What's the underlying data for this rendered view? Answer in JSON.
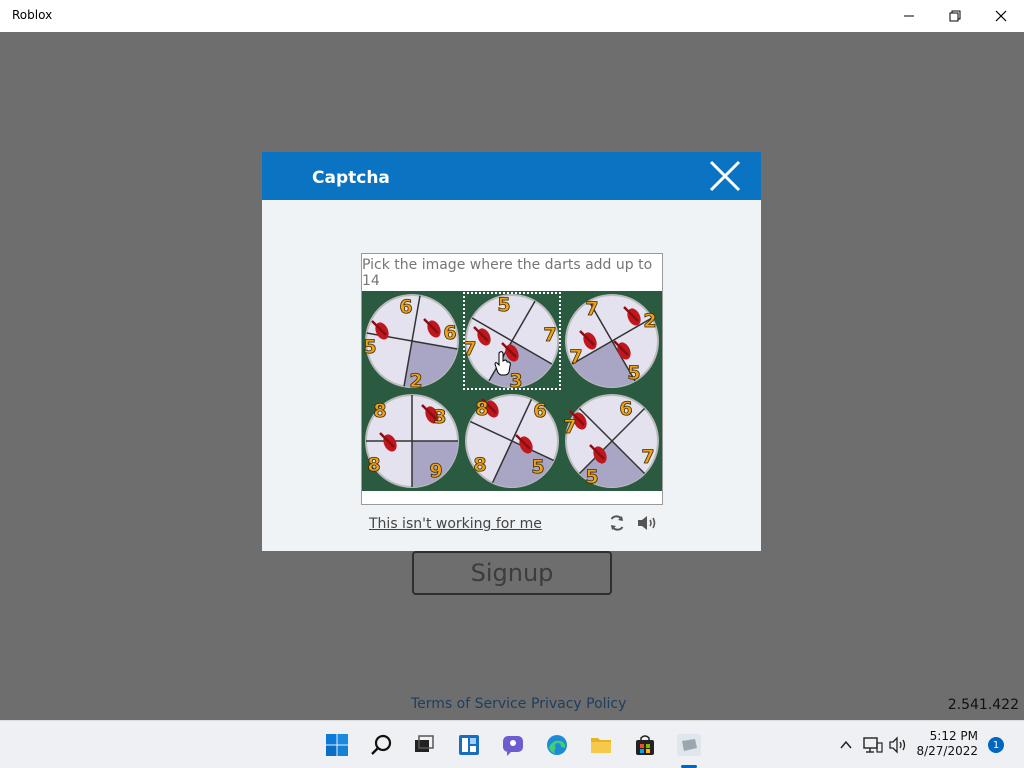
{
  "window": {
    "title": "Roblox",
    "controls": [
      "minimize-icon",
      "restore-icon",
      "close-icon"
    ]
  },
  "page": {
    "signup_label": "Signup",
    "footer": {
      "terms": "Terms of Service",
      "privacy": "Privacy Policy"
    },
    "version": "2.541.422"
  },
  "captcha": {
    "title": "Captcha",
    "prompt": "Pick the image where the darts add up to 14",
    "selected_index": 1,
    "tiles": [
      {
        "numbers": [
          "6",
          "6",
          "5",
          "2"
        ]
      },
      {
        "numbers": [
          "5",
          "7",
          "7",
          "3"
        ]
      },
      {
        "numbers": [
          "7",
          "2",
          "7",
          "5"
        ]
      },
      {
        "numbers": [
          "8",
          "3",
          "8",
          "9"
        ]
      },
      {
        "numbers": [
          "8",
          "6",
          "8",
          "5"
        ]
      },
      {
        "numbers": [
          "6",
          "7",
          "7",
          "5"
        ]
      }
    ],
    "help_link": "This isn't working for me",
    "icons": [
      "refresh-icon",
      "audio-icon"
    ]
  },
  "taskbar": {
    "apps": [
      "windows-start-icon",
      "search-icon",
      "task-view-icon",
      "widgets-icon",
      "chat-icon",
      "edge-icon",
      "file-explorer-icon",
      "store-icon",
      "roblox-icon"
    ],
    "tray": [
      "chevron-up-icon",
      "network-icon",
      "volume-icon"
    ],
    "time": "5:12 PM",
    "date": "8/27/2022",
    "notification_count": "1"
  },
  "colors": {
    "header_blue": "#0a73c2",
    "backdrop": "#6e6e6e",
    "tile_green": "#2a5a3f",
    "accent": "#0067c0"
  }
}
